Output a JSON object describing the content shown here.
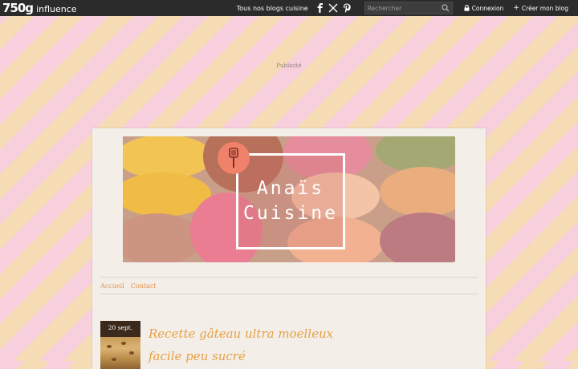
{
  "topbar": {
    "logo_number": "750g",
    "logo_word": "influence",
    "all_blogs_label": "Tous nos blogs cuisine",
    "social_icons": [
      "facebook-icon",
      "x-icon",
      "pinterest-icon"
    ],
    "search_placeholder": "Rechercher",
    "login_label": "Connexion",
    "create_blog_label": "Créer mon blog",
    "background_color": "#2b2b2b"
  },
  "ad": {
    "label": "Publicité"
  },
  "blog": {
    "title_line1": "Anaïs",
    "title_line2": "Cuisine",
    "nav": [
      "Accueil",
      "Contact"
    ],
    "accent_color": "#e0944e"
  },
  "post": {
    "date": "20 sept.",
    "title": "Recette gâteau ultra moelleux facile peu sucré",
    "title_color": "#e5a043"
  },
  "background_stripes": [
    "#f8cfdc",
    "#f6dcb4"
  ]
}
